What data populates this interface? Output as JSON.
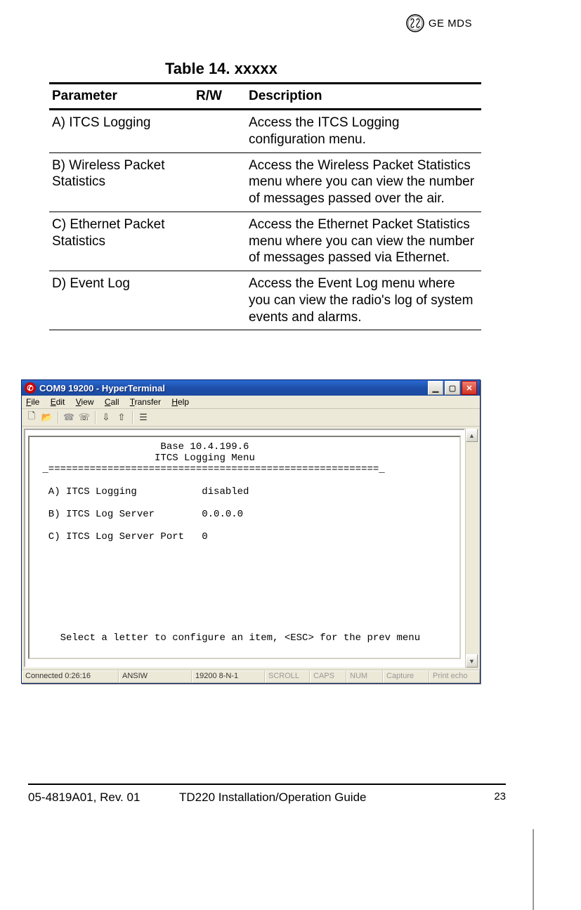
{
  "header": {
    "brand": "GE MDS"
  },
  "table": {
    "title": "Table 14. xxxxx",
    "columns": [
      "Parameter",
      "R/W",
      "Description"
    ],
    "rows": [
      {
        "param": "A) ITCS Logging",
        "rw": "",
        "desc": "Access the ITCS Logging configuration menu."
      },
      {
        "param": "B) Wireless Packet Statistics",
        "rw": "",
        "desc": "Access the Wireless Packet Statistics menu where you can view the number of messages passed over the air."
      },
      {
        "param": "C) Ethernet Packet Statistics",
        "rw": "",
        "desc": "Access the Ethernet Packet Statistics menu where you can view the number of messages passed via Ethernet."
      },
      {
        "param": "D) Event Log",
        "rw": "",
        "desc": "Access the Event Log menu where you can view the radio's log of system events and alarms."
      }
    ]
  },
  "hyperterminal": {
    "title": "COM9 19200 - HyperTerminal",
    "menu": [
      "File",
      "Edit",
      "View",
      "Call",
      "Transfer",
      "Help"
    ],
    "terminal": {
      "header1": "Base 10.4.199.6",
      "header2": "ITCS Logging Menu",
      "lines": [
        {
          "label": "A) ITCS Logging",
          "value": "disabled"
        },
        {
          "label": "B) ITCS Log Server",
          "value": "0.0.0.0"
        },
        {
          "label": "C) ITCS Log Server Port",
          "value": "0"
        }
      ],
      "prompt": "Select a letter to configure an item, <ESC> for the prev menu"
    },
    "status": {
      "conn": "Connected 0:26:16",
      "emu": "ANSIW",
      "port": "19200 8-N-1",
      "scroll": "SCROLL",
      "caps": "CAPS",
      "num": "NUM",
      "capture": "Capture",
      "echo": "Print echo"
    }
  },
  "footer": {
    "left": "05-4819A01, Rev. 01",
    "center": "TD220 Installation/Operation Guide",
    "right": "23"
  }
}
